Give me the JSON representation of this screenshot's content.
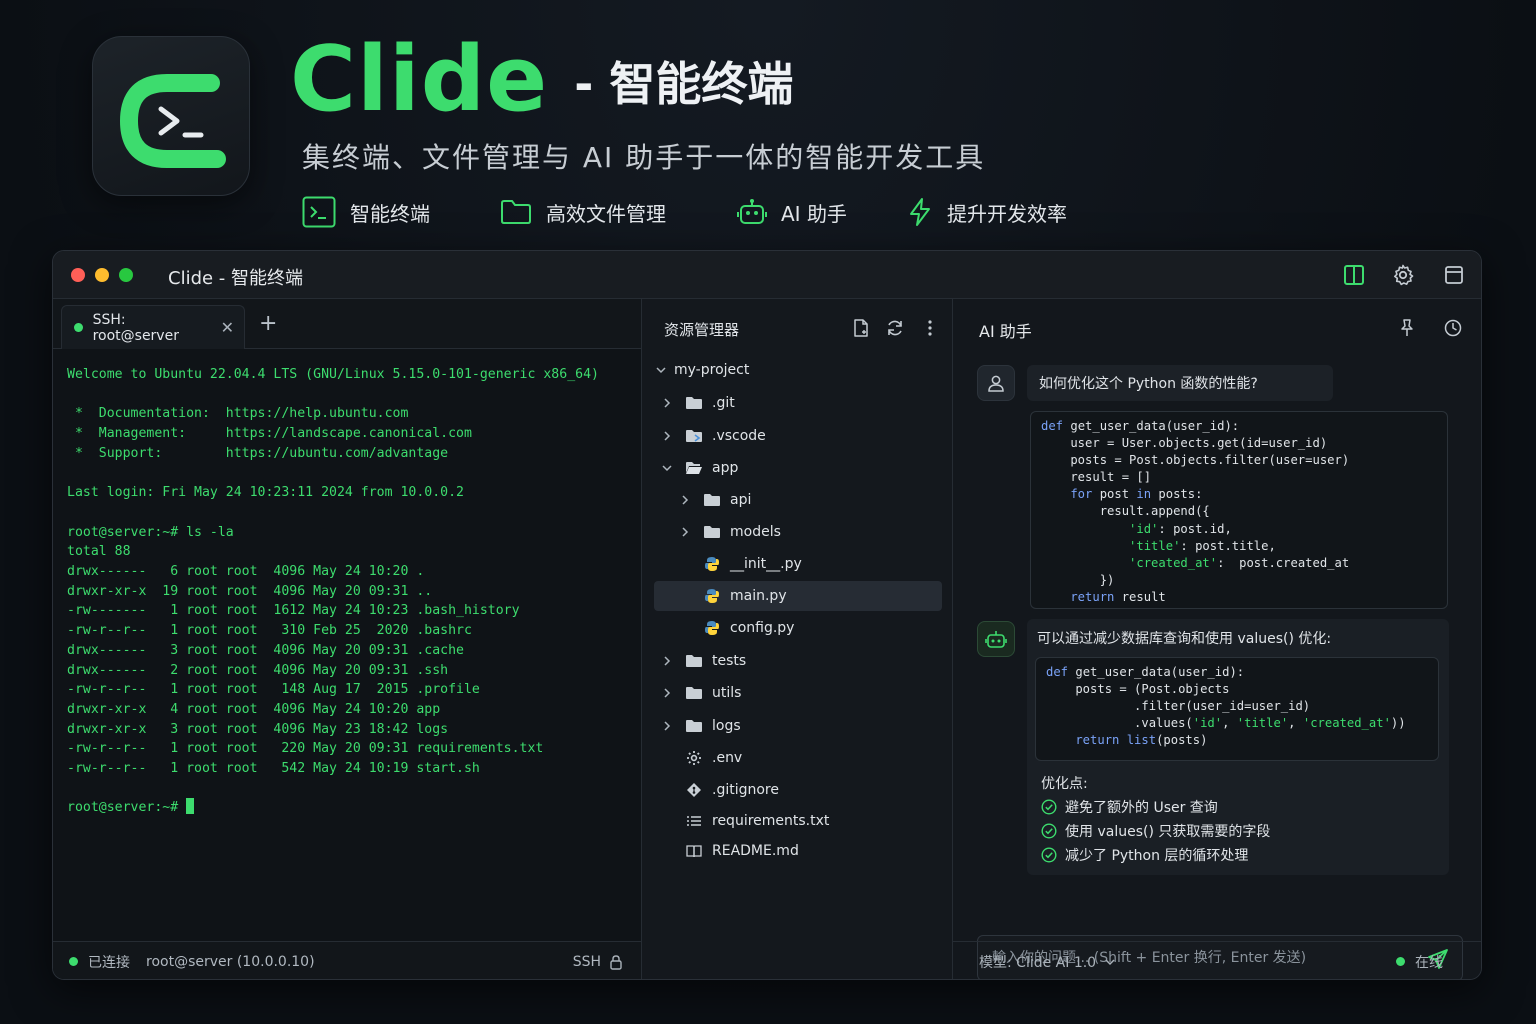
{
  "hero": {
    "brand": "Clide",
    "title_suffix": "- 智能终端",
    "subtitle": "集终端、文件管理与 AI 助手于一体的智能开发工具",
    "features": [
      {
        "icon": "terminal-icon",
        "label": "智能终端"
      },
      {
        "icon": "folder-icon",
        "label": "高效文件管理"
      },
      {
        "icon": "robot-icon",
        "label": "AI 助手"
      },
      {
        "icon": "lightning-icon",
        "label": "提升开发效率"
      }
    ]
  },
  "colors": {
    "accent": "#3ddc6e",
    "background": "#0d1117",
    "keyword": "#7aa2f7"
  },
  "window": {
    "title": "Clide - 智能终端",
    "toolbar_icons": [
      "split-view-icon",
      "gear-icon",
      "window-icon"
    ]
  },
  "terminal": {
    "tab_label": "SSH: root@server",
    "lines": [
      "Welcome to Ubuntu 22.04.4 LTS (GNU/Linux 5.15.0-101-generic x86_64)",
      "",
      " *  Documentation:  https://help.ubuntu.com",
      " *  Management:     https://landscape.canonical.com",
      " *  Support:        https://ubuntu.com/advantage",
      "",
      "Last login: Fri May 24 10:23:11 2024 from 10.0.0.2",
      "",
      "root@server:~# ls -la",
      "total 88",
      "drwx------   6 root root  4096 May 24 10:20 .",
      "drwxr-xr-x  19 root root  4096 May 20 09:31 ..",
      "-rw-------   1 root root  1612 May 24 10:23 .bash_history",
      "-rw-r--r--   1 root root   310 Feb 25  2020 .bashrc",
      "drwx------   3 root root  4096 May 20 09:31 .cache",
      "drwx------   2 root root  4096 May 20 09:31 .ssh",
      "-rw-r--r--   1 root root   148 Aug 17  2015 .profile",
      "drwxr-xr-x   4 root root  4096 May 24 10:20 app",
      "drwxr-xr-x   3 root root  4096 May 23 18:42 logs",
      "-rw-r--r--   1 root root   220 May 20 09:31 requirements.txt",
      "-rw-r--r--   1 root root   542 May 24 10:19 start.sh",
      ""
    ],
    "prompt": "root@server:~# ",
    "status": {
      "connected": "已连接",
      "host": "root@server (10.0.0.10)",
      "protocol": "SSH"
    }
  },
  "explorer": {
    "title": "资源管理器",
    "items": [
      {
        "label": "my-project",
        "depth": 0,
        "chev": "down",
        "icon": "none"
      },
      {
        "label": ".git",
        "depth": 1,
        "chev": "right",
        "icon": "folder"
      },
      {
        "label": ".vscode",
        "depth": 1,
        "chev": "right",
        "icon": "vscode-folder"
      },
      {
        "label": "app",
        "depth": 1,
        "chev": "down",
        "icon": "folder-open"
      },
      {
        "label": "api",
        "depth": 2,
        "chev": "right",
        "icon": "folder"
      },
      {
        "label": "models",
        "depth": 2,
        "chev": "right",
        "icon": "folder"
      },
      {
        "label": "__init__.py",
        "depth": 2,
        "chev": "none",
        "icon": "python"
      },
      {
        "label": "main.py",
        "depth": 2,
        "chev": "none",
        "icon": "python",
        "selected": true
      },
      {
        "label": "config.py",
        "depth": 2,
        "chev": "none",
        "icon": "python"
      },
      {
        "label": "tests",
        "depth": 1,
        "chev": "right",
        "icon": "folder"
      },
      {
        "label": "utils",
        "depth": 1,
        "chev": "right",
        "icon": "folder"
      },
      {
        "label": "logs",
        "depth": 1,
        "chev": "right",
        "icon": "folder"
      },
      {
        "label": ".env",
        "depth": 1,
        "chev": "none",
        "icon": "gear"
      },
      {
        "label": ".gitignore",
        "depth": 1,
        "chev": "none",
        "icon": "git"
      },
      {
        "label": "requirements.txt",
        "depth": 1,
        "chev": "none",
        "icon": "list"
      },
      {
        "label": "README.md",
        "depth": 1,
        "chev": "none",
        "icon": "book"
      }
    ]
  },
  "ai": {
    "title": "AI 助手",
    "question": "如何优化这个 Python 函数的性能?",
    "question_code": [
      [
        [
          "kw",
          "def "
        ],
        [
          "fn",
          "get_user_data(user_id):"
        ]
      ],
      [
        [
          "fn",
          "    user = User.objects.get(id=user_id)"
        ]
      ],
      [
        [
          "fn",
          "    posts = Post.objects.filter(user=user)"
        ]
      ],
      [
        [
          "fn",
          "    result = []"
        ]
      ],
      [
        [
          "kw",
          "    for "
        ],
        [
          "fn",
          "post "
        ],
        [
          "kw",
          "in "
        ],
        [
          "fn",
          "posts:"
        ]
      ],
      [
        [
          "fn",
          "        result.append({"
        ]
      ],
      [
        [
          "str",
          "            'id'"
        ],
        [
          "fn",
          ": post.id,"
        ]
      ],
      [
        [
          "str",
          "            'title'"
        ],
        [
          "fn",
          ": post.title,"
        ]
      ],
      [
        [
          "str",
          "            'created_at'"
        ],
        [
          "fn",
          ":  post.created_at"
        ]
      ],
      [
        [
          "fn",
          "        })"
        ]
      ],
      [
        [
          "kw",
          "    return "
        ],
        [
          "fn",
          "result"
        ]
      ]
    ],
    "answer_intro": "可以通过减少数据库查询和使用 values() 优化:",
    "answer_code": [
      [
        [
          "kw",
          "def "
        ],
        [
          "fn",
          "get_user_data(user_id):"
        ]
      ],
      [
        [
          "fn",
          "    posts = (Post.objects"
        ]
      ],
      [
        [
          "fn",
          "            .filter(user_id=user_id)"
        ]
      ],
      [
        [
          "fn",
          "            .values("
        ],
        [
          "str",
          "'id'"
        ],
        [
          "fn",
          ", "
        ],
        [
          "str",
          "'title'"
        ],
        [
          "fn",
          ", "
        ],
        [
          "str",
          "'created_at'"
        ],
        [
          "fn",
          "))"
        ]
      ],
      [
        [
          "kw",
          "    return "
        ],
        [
          "kw",
          "list"
        ],
        [
          "fn",
          "(posts)"
        ]
      ]
    ],
    "points_title": "优化点:",
    "points": [
      "避免了额外的 User 查询",
      "使用 values() 只获取需要的字段",
      "减少了 Python 层的循环处理"
    ],
    "input_placeholder": "輸入你的问题... (Shift + Enter 换行, Enter 发送)",
    "model_label": "模型: Clide AI 1.0",
    "online": "在线"
  }
}
